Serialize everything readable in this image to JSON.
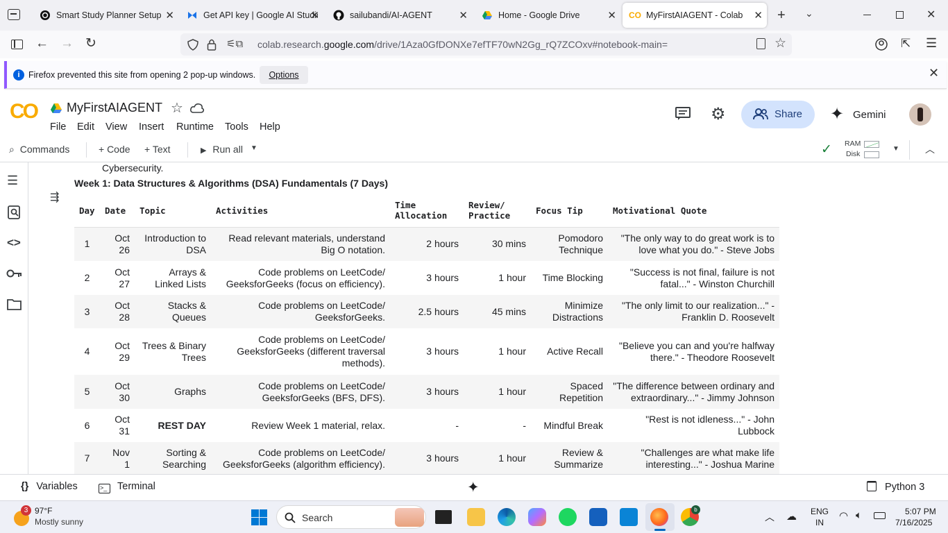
{
  "browser": {
    "tabs": [
      {
        "title": "Smart Study Planner Setup",
        "icon": "chatgpt-icon"
      },
      {
        "title": "Get API key | Google AI Studio",
        "icon": "ai-studio-icon"
      },
      {
        "title": "sailubandi/AI-AGENT",
        "icon": "github-icon"
      },
      {
        "title": "Home - Google Drive",
        "icon": "google-drive-icon"
      },
      {
        "title": "MyFirstAIAGENT - Colab",
        "icon": "colab-icon"
      }
    ],
    "url_prefix": "colab.research.",
    "url_domain": "google.com",
    "url_path": "/drive/1Aza0GfDONXe7efTF70wN2Gg_rQ7ZCOxv#notebook-main=",
    "notification": "Firefox prevented this site from opening 2 pop-up windows.",
    "notification_button": "Options"
  },
  "colab": {
    "logo": "CO",
    "notebook_title": "MyFirstAIAGENT",
    "menu": [
      "File",
      "Edit",
      "View",
      "Insert",
      "Runtime",
      "Tools",
      "Help"
    ],
    "share_label": "Share",
    "gemini_label": "Gemini",
    "toolbar": {
      "commands": "Commands",
      "code": "+ Code",
      "text": "+ Text",
      "run_all": "Run all",
      "ram": "RAM",
      "disk": "Disk"
    }
  },
  "content": {
    "previous_text": "Cybersecurity.",
    "week_title": "Week 1: Data Structures & Algorithms (DSA) Fundamentals (7 Days)",
    "headers": [
      "Day",
      "Date",
      "Topic",
      "Activities",
      "Time Allocation",
      "Review/ Practice",
      "Focus Tip",
      "Motivational Quote"
    ],
    "rows": [
      [
        "1",
        "Oct 26",
        "Introduction to DSA",
        "Read relevant materials, understand Big O notation.",
        "2 hours",
        "30 mins",
        "Pomodoro Technique",
        "\"The only way to do great work is to love what you do.\" - Steve Jobs"
      ],
      [
        "2",
        "Oct 27",
        "Arrays & Linked Lists",
        "Code problems on LeetCode/ GeeksforGeeks (focus on efficiency).",
        "3 hours",
        "1 hour",
        "Time Blocking",
        "\"Success is not final, failure is not fatal...\" - Winston Churchill"
      ],
      [
        "3",
        "Oct 28",
        "Stacks & Queues",
        "Code problems on LeetCode/ GeeksforGeeks.",
        "2.5 hours",
        "45 mins",
        "Minimize Distractions",
        "\"The only limit to our realization...\" - Franklin D. Roosevelt"
      ],
      [
        "4",
        "Oct 29",
        "Trees & Binary Trees",
        "Code problems on LeetCode/ GeeksforGeeks (different traversal methods).",
        "3 hours",
        "1 hour",
        "Active Recall",
        "\"Believe you can and you're halfway there.\" - Theodore Roosevelt"
      ],
      [
        "5",
        "Oct 30",
        "Graphs",
        "Code problems on LeetCode/ GeeksforGeeks (BFS, DFS).",
        "3 hours",
        "1 hour",
        "Spaced Repetition",
        "\"The difference between ordinary and extraordinary...\" - Jimmy Johnson"
      ],
      [
        "6",
        "Oct 31",
        "REST DAY",
        "Review Week 1 material, relax.",
        "-",
        "-",
        "Mindful Break",
        "\"Rest is not idleness...\" - John Lubbock"
      ],
      [
        "7",
        "Nov 1",
        "Sorting & Searching",
        "Code problems on LeetCode/ GeeksforGeeks (algorithm efficiency).",
        "3 hours",
        "1 hour",
        "Review & Summarize",
        "\"Challenges are what make life interesting...\" - Joshua Marine"
      ]
    ]
  },
  "statusbar": {
    "variables": "Variables",
    "terminal": "Terminal",
    "runtime": "Python 3"
  },
  "taskbar": {
    "weather_temp": "97°F",
    "weather_desc": "Mostly sunny",
    "weather_badge": "3",
    "search": "Search",
    "lang": "ENG",
    "region": "IN",
    "time": "5:07 PM",
    "date": "7/16/2025"
  }
}
